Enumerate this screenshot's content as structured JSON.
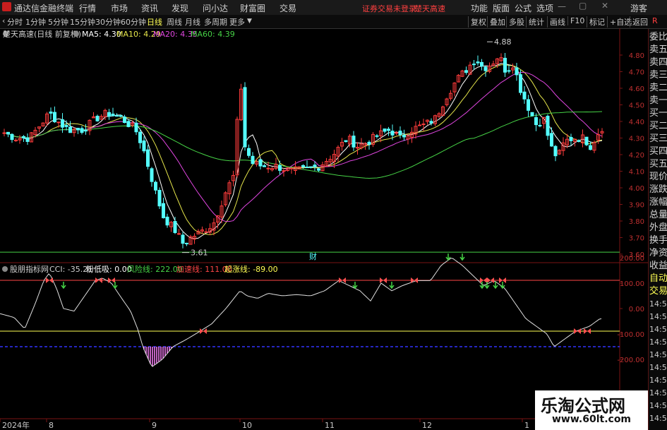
{
  "topbar": {
    "app_title": "通达信金融终端",
    "menus": [
      "行情",
      "市场",
      "资讯",
      "发现",
      "问小达",
      "财富圈",
      "交易"
    ],
    "warning": "证券交易未登录",
    "stock": "楚天高速",
    "right_menus": [
      "功能",
      "版面",
      "公式",
      "选项"
    ],
    "guest": "游客"
  },
  "toolbar": {
    "periods": [
      "分时",
      "1分钟",
      "5分钟",
      "15分钟",
      "30分钟",
      "60分钟",
      "日线",
      "周线",
      "月线",
      "多周期",
      "更多"
    ],
    "active_period": "日线",
    "right_buttons": [
      "复权",
      "叠加",
      "多股",
      "统计",
      "画线",
      "F10",
      "标记",
      "+自选",
      "返回"
    ],
    "r_mark": "R"
  },
  "main_chart": {
    "title": "楚天高速(日线 前复权)",
    "ma_labels": [
      "MA5: 4.30",
      "MA10: 4.29",
      "MA20: 4.35",
      "MA60: 4.39"
    ],
    "ma_colors": [
      "#ffffff",
      "#e6e64b",
      "#e046e0",
      "#46d246"
    ],
    "price_ticks": [
      "4.80",
      "4.70",
      "4.60",
      "4.50",
      "4.40",
      "4.30",
      "4.20",
      "4.10",
      "4.00",
      "3.90",
      "3.80",
      "3.70",
      "3.60"
    ],
    "high_label": "4.88",
    "low_label": "3.61",
    "event_marker": "财"
  },
  "indicator": {
    "title": "股朋指标网",
    "items": [
      "CCI: -35.21",
      "粉低吸: 0.00",
      "风险线: 222.00",
      "加速线: 111.00",
      "起涨线: -89.00"
    ],
    "item_colors": [
      "#d0d0d0",
      "#ffffff",
      "#46d246",
      "#ff4646",
      "#ffff54"
    ],
    "ticks": [
      "200.00",
      "100.00",
      "0.00",
      "-100.00",
      "-200.00"
    ]
  },
  "xaxis": {
    "labels": [
      "2024年",
      "8",
      "9",
      "10",
      "11",
      "12",
      "1"
    ]
  },
  "sidebar": {
    "items": [
      "委比",
      "卖五",
      "卖四",
      "卖三",
      "卖二",
      "卖一",
      "买一",
      "买二",
      "买三",
      "买四",
      "买五",
      "现价",
      "涨跌",
      "涨幅",
      "总量",
      "外盘",
      "换手",
      "净资",
      "收益",
      "自动",
      "交易",
      "14:56",
      "14:56",
      "14:56",
      "14:56",
      "14:56",
      "14:56",
      "14:56",
      "14:56",
      "14:56",
      "14:56"
    ]
  },
  "watermark": {
    "line1": "乐淘公式网",
    "line2": "www.60lt.com"
  },
  "colors": {
    "up": "#ff3c3c",
    "down": "#54ffff",
    "panel_red": "#7a1414",
    "blue_line": "#3232ff"
  }
}
